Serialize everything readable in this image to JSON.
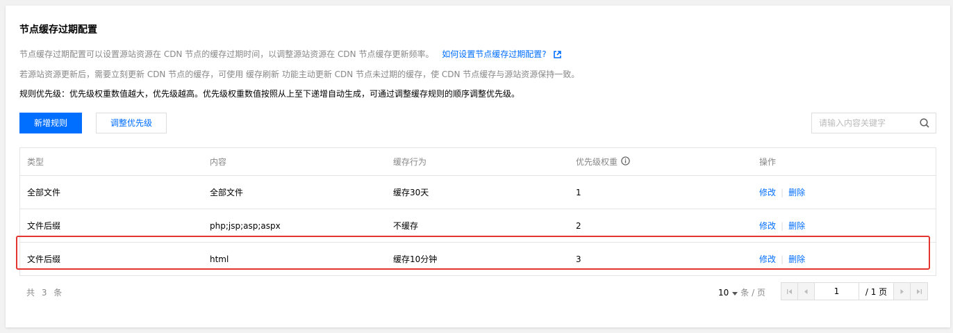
{
  "card": {
    "title": "节点缓存过期配置",
    "desc1": "节点缓存过期配置可以设置源站资源在 CDN 节点的缓存过期时间，以调整源站资源在 CDN 节点缓存更新频率。",
    "help_link": "如何设置节点缓存过期配置?",
    "desc2": "若源站资源更新后，需要立刻更新 CDN 节点的缓存，可使用 缓存刷新 功能主动更新 CDN 节点未过期的缓存，使 CDN 节点缓存与源站资源保持一致。",
    "desc3": "规则优先级：优先级权重数值越大，优先级越高。优先级权重数值按照从上至下递增自动生成，可通过调整缓存规则的顺序调整优先级。"
  },
  "toolbar": {
    "add_label": "新增规则",
    "adjust_label": "调整优先级",
    "search_placeholder": "请输入内容关键字"
  },
  "table": {
    "columns": [
      "类型",
      "内容",
      "缓存行为",
      "优先级权重",
      "操作"
    ],
    "rows": [
      {
        "type": "全部文件",
        "content": "全部文件",
        "behavior": "缓存30天",
        "priority": "1",
        "edit": "修改",
        "del": "删除"
      },
      {
        "type": "文件后缀",
        "content": "php;jsp;asp;aspx",
        "behavior": "不缓存",
        "priority": "2",
        "edit": "修改",
        "del": "删除"
      },
      {
        "type": "文件后缀",
        "content": "html",
        "behavior": "缓存10分钟",
        "priority": "3",
        "edit": "修改",
        "del": "删除"
      }
    ]
  },
  "footer": {
    "total": "共 3 条",
    "page_size": "10",
    "page_size_unit": "条 / 页",
    "current_page": "1",
    "total_pages": "/ 1 页"
  },
  "colors": {
    "accent": "#006eff",
    "highlight": "#e3342f"
  },
  "icons": [
    "external-link-icon",
    "search-icon",
    "info-icon",
    "caret-down-icon",
    "first-page-icon",
    "prev-page-icon",
    "next-page-icon",
    "last-page-icon"
  ]
}
